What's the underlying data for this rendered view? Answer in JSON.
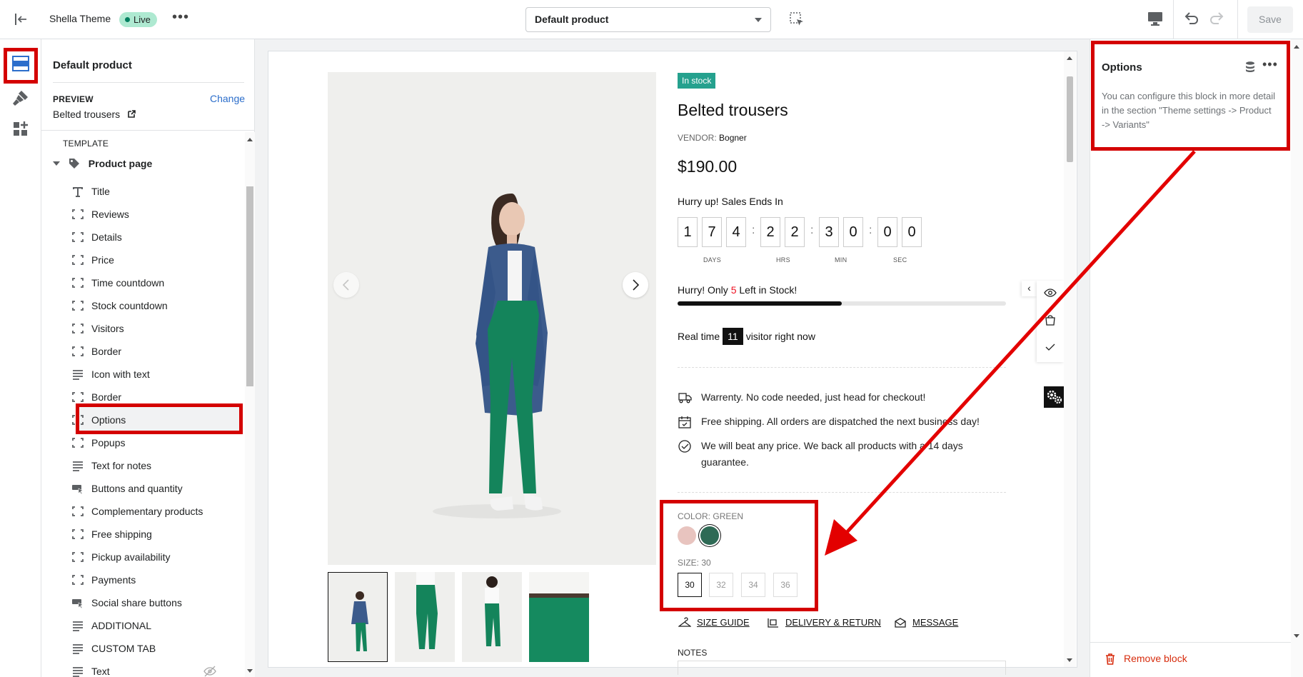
{
  "topbar": {
    "theme_name": "Shella Theme",
    "status_badge": "Live",
    "more_label": "•••",
    "template_select": "Default product",
    "save_label": "Save"
  },
  "sidebar": {
    "title": "Default product",
    "preview_label": "PREVIEW",
    "change_label": "Change",
    "preview_value": "Belted trousers",
    "template_label": "TEMPLATE",
    "section_name": "Product page",
    "items": [
      {
        "label": "Title",
        "icon": "title-icon"
      },
      {
        "label": "Reviews",
        "icon": "block-icon"
      },
      {
        "label": "Details",
        "icon": "block-icon"
      },
      {
        "label": "Price",
        "icon": "block-icon"
      },
      {
        "label": "Time countdown",
        "icon": "block-icon"
      },
      {
        "label": "Stock countdown",
        "icon": "block-icon"
      },
      {
        "label": "Visitors",
        "icon": "block-icon"
      },
      {
        "label": "Border",
        "icon": "block-icon"
      },
      {
        "label": "Icon with text",
        "icon": "text-lines-icon"
      },
      {
        "label": "Border",
        "icon": "block-icon"
      },
      {
        "label": "Options",
        "icon": "block-icon"
      },
      {
        "label": "Popups",
        "icon": "block-icon"
      },
      {
        "label": "Text for notes",
        "icon": "text-lines-icon"
      },
      {
        "label": "Buttons and quantity",
        "icon": "buttons-icon"
      },
      {
        "label": "Complementary products",
        "icon": "block-icon"
      },
      {
        "label": "Free shipping",
        "icon": "block-icon"
      },
      {
        "label": "Pickup availability",
        "icon": "block-icon"
      },
      {
        "label": "Payments",
        "icon": "block-icon"
      },
      {
        "label": "Social share buttons",
        "icon": "buttons-icon"
      },
      {
        "label": "ADDITIONAL",
        "icon": "text-lines-icon"
      },
      {
        "label": "CUSTOM TAB",
        "icon": "text-lines-icon"
      },
      {
        "label": "Text",
        "icon": "text-lines-icon"
      }
    ]
  },
  "product": {
    "stock_badge": "In stock",
    "title": "Belted trousers",
    "vendor_label": "VENDOR:",
    "vendor": "Bogner",
    "price": "$190.00",
    "hurry_text": "Hurry up! Sales Ends In",
    "countdown": {
      "days": [
        "1",
        "7",
        "4"
      ],
      "hrs": [
        "2",
        "2"
      ],
      "min": [
        "3",
        "0"
      ],
      "sec": [
        "0",
        "0"
      ],
      "days_label": "DAYS",
      "hrs_label": "HRS",
      "min_label": "MIN",
      "sec_label": "SEC"
    },
    "stock_msg_pre": "Hurry! Only ",
    "stock_count": "5",
    "stock_msg_post": " Left in Stock!",
    "stock_progress": 0.5,
    "visitor_pre": "Real time",
    "visitor_count": "11",
    "visitor_post": "visitor right now",
    "features": [
      "Warrenty. No code needed, just head for checkout!",
      "Free shipping. All orders are dispatched the next business day!",
      "We will beat any price. We back all products with a 14 days guarantee."
    ],
    "color_label": "COLOR:",
    "color_value": "GREEN",
    "colors": [
      "#e8c4bf",
      "#2e6a55"
    ],
    "size_label": "SIZE:",
    "size_value": "30",
    "sizes": [
      "30",
      "32",
      "34",
      "36"
    ],
    "links": [
      "SIZE GUIDE",
      "DELIVERY & RETURN",
      "MESSAGE"
    ],
    "notes_label": "NOTES"
  },
  "right_panel": {
    "title": "Options",
    "more_label": "•••",
    "description": "You can configure this block in more detail in the section \"Theme settings -> Product -> Variants\"",
    "remove_label": "Remove block"
  },
  "colors": {
    "accent_red": "#d40000",
    "stock_green": "#25a18e",
    "link_blue": "#2c6ecb"
  }
}
